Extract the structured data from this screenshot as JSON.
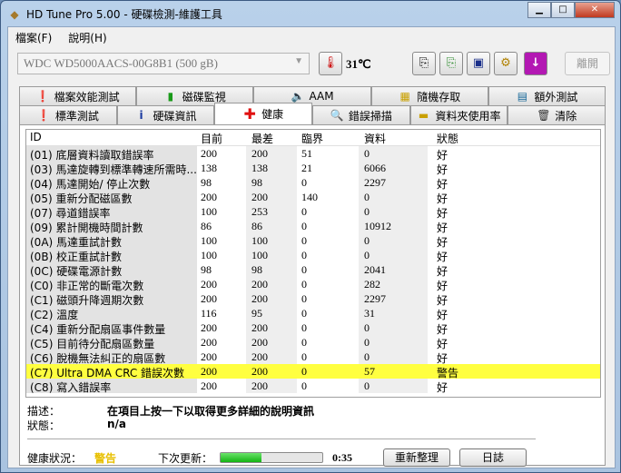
{
  "window": {
    "title": "HD Tune Pro  5.00 - 硬碟檢測-維護工具"
  },
  "menu": [
    "檔案(F)",
    "說明(H)"
  ],
  "toolbar": {
    "drive": "WDC WD5000AACS-00G8B1 (500 gB)",
    "temperature": "31℃",
    "exit": "離開"
  },
  "tabs_row1": [
    "檔案效能測試",
    "磁碟監視",
    "AAM",
    "隨機存取",
    "額外測試"
  ],
  "tabs_row2": [
    "標準測試",
    "硬碟資訊",
    "健康",
    "錯誤掃描",
    "資料夾使用率",
    "清除"
  ],
  "table": {
    "headers": [
      "ID",
      "目前",
      "最差",
      "臨界",
      "資料",
      "狀態"
    ],
    "rows": [
      [
        "(01) 底層資料讀取錯誤率",
        "200",
        "200",
        "51",
        "0",
        "好"
      ],
      [
        "(03) 馬達旋轉到標準轉速所需時...",
        "138",
        "138",
        "21",
        "6066",
        "好"
      ],
      [
        "(04) 馬達開始/ 停止次數",
        "98",
        "98",
        "0",
        "2297",
        "好"
      ],
      [
        "(05) 重新分配磁區數",
        "200",
        "200",
        "140",
        "0",
        "好"
      ],
      [
        "(07) 尋道錯誤率",
        "100",
        "253",
        "0",
        "0",
        "好"
      ],
      [
        "(09) 累計開機時間計數",
        "86",
        "86",
        "0",
        "10912",
        "好"
      ],
      [
        "(0A) 馬達重試計數",
        "100",
        "100",
        "0",
        "0",
        "好"
      ],
      [
        "(0B) 校正重試計數",
        "100",
        "100",
        "0",
        "0",
        "好"
      ],
      [
        "(0C) 硬碟電源計數",
        "98",
        "98",
        "0",
        "2041",
        "好"
      ],
      [
        "(C0) 非正常的斷電次數",
        "200",
        "200",
        "0",
        "282",
        "好"
      ],
      [
        "(C1) 磁頭升降週期次數",
        "200",
        "200",
        "0",
        "2297",
        "好"
      ],
      [
        "(C2) 溫度",
        "116",
        "95",
        "0",
        "31",
        "好"
      ],
      [
        "(C4) 重新分配扇區事件數量",
        "200",
        "200",
        "0",
        "0",
        "好"
      ],
      [
        "(C5) 目前待分配扇區數量",
        "200",
        "200",
        "0",
        "0",
        "好"
      ],
      [
        "(C6) 脫機無法糾正的扇區數",
        "200",
        "200",
        "0",
        "0",
        "好"
      ],
      [
        "(C7) Ultra DMA CRC 錯誤次數",
        "200",
        "200",
        "0",
        "57",
        "警告"
      ],
      [
        "(C8) 寫入錯誤率",
        "200",
        "200",
        "0",
        "0",
        "好"
      ]
    ],
    "highlight_row": 15,
    "highlight_color": "#ffff40"
  },
  "details": {
    "desc_label": "描述：",
    "desc_value": "在項目上按一下以取得更多詳細的說明資訊",
    "status_label": "狀態：",
    "status_value": "n/a"
  },
  "status": {
    "health_label": "健康狀況：",
    "health_value": "警告",
    "next_label": "下次更新：",
    "progress": 0.4,
    "countdown": "0:35",
    "refresh": "重新整理",
    "log": "日誌"
  }
}
